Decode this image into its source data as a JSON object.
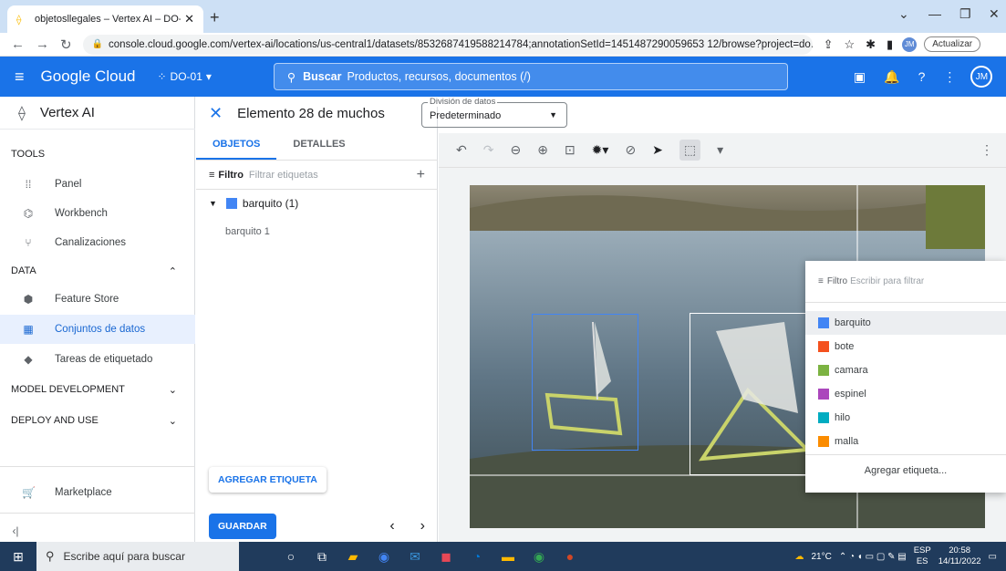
{
  "browser": {
    "tab_title": "objetosllegales – Vertex AI – DO-",
    "url": "console.cloud.google.com/vertex-ai/locations/us-central1/datasets/8532687419588214784;annotationSetId=1451487290059653 12/browse?project=do...",
    "update_label": "Actualizar",
    "profile_initials": "JM"
  },
  "gcp": {
    "brand": "Google Cloud",
    "project": "DO-01",
    "search_label": "Buscar",
    "search_placeholder": "Productos, recursos, documentos (/)",
    "user_initials": "JM"
  },
  "nav": {
    "product": "Vertex AI",
    "sections": {
      "tools": "TOOLS",
      "data": "DATA",
      "model_dev": "MODEL DEVELOPMENT",
      "deploy": "DEPLOY AND USE"
    },
    "items": {
      "panel": "Panel",
      "workbench": "Workbench",
      "pipelines": "Canalizaciones",
      "feature_store": "Feature Store",
      "datasets": "Conjuntos de datos",
      "labeling": "Tareas de etiquetado",
      "marketplace": "Marketplace"
    }
  },
  "panel": {
    "title": "Elemento 28 de muchos",
    "tabs": {
      "objects": "OBJETOS",
      "details": "DETALLES"
    },
    "filter_label": "Filtro",
    "filter_placeholder": "Filtrar etiquetas",
    "group_label": "barquito (1)",
    "annotation": "barquito 1",
    "add_label": "AGREGAR ETIQUETA",
    "save": "GUARDAR"
  },
  "split": {
    "legend": "División de datos",
    "value": "Predeterminado"
  },
  "label_menu": {
    "filter_label": "Filtro",
    "filter_placeholder": "Escribir para filtrar",
    "items": [
      {
        "name": "barquito",
        "color": "#4285f4"
      },
      {
        "name": "bote",
        "color": "#f4511e"
      },
      {
        "name": "camara",
        "color": "#7cb342"
      },
      {
        "name": "espinel",
        "color": "#ab47bc"
      },
      {
        "name": "hilo",
        "color": "#00acc1"
      },
      {
        "name": "malla",
        "color": "#fb8c00"
      }
    ],
    "add": "Agregar etiqueta..."
  },
  "taskbar": {
    "search_placeholder": "Escribe aquí para buscar",
    "temp": "21°C",
    "lang1": "ESP",
    "lang2": "ES",
    "time": "20:58",
    "date": "14/11/2022"
  }
}
